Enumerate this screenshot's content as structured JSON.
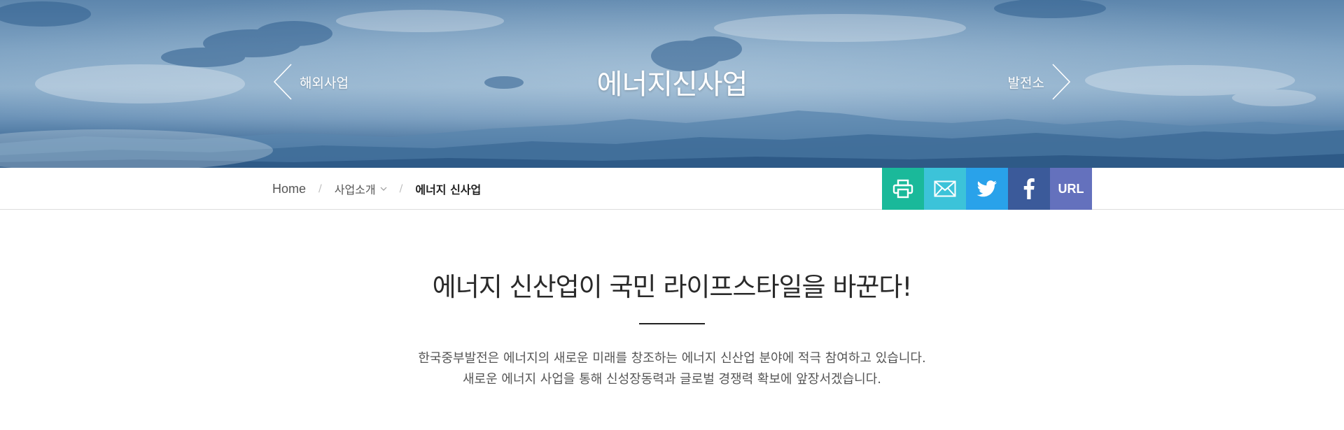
{
  "hero": {
    "title": "에너지신사업",
    "prev_label": "해외사업",
    "next_label": "발전소"
  },
  "breadcrumb": {
    "home": "Home",
    "separator": "/",
    "parent": "사업소개",
    "current": "에너지 신사업"
  },
  "share": {
    "buttons": [
      {
        "name": "print",
        "icon": "print-icon",
        "color": "#1ab99a"
      },
      {
        "name": "email",
        "icon": "mail-icon",
        "color": "#3cc3d9"
      },
      {
        "name": "twitter",
        "icon": "twitter-icon",
        "color": "#29a2ea"
      },
      {
        "name": "facebook",
        "icon": "facebook-icon",
        "color": "#3b5a9a"
      },
      {
        "name": "url",
        "icon": "link-icon",
        "color": "#6471bd"
      }
    ],
    "url_label": "URL"
  },
  "content": {
    "headline": "에너지 신산업이 국민 라이프스타일을 바꾼다!",
    "desc_line1": "한국중부발전은 에너지의 새로운 미래를 창조하는 에너지 신산업 분야에 적극 참여하고 있습니다.",
    "desc_line2": "새로운 에너지 사업을 통해 신성장동력과 글로벌 경쟁력 확보에 앞장서겠습니다."
  }
}
